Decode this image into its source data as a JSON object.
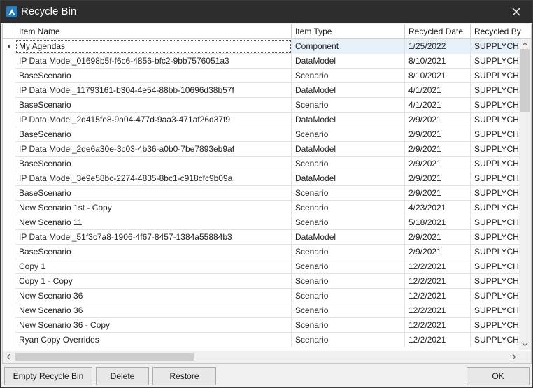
{
  "window": {
    "title": "Recycle Bin",
    "icon": "app-logo-icon",
    "accent": "#1f7fc4"
  },
  "columns": [
    "Item Name",
    "Item Type",
    "Recycled Date",
    "Recycled By"
  ],
  "rows": [
    {
      "name": "My Agendas",
      "type": "Component",
      "date": "1/25/2022",
      "by": "SUPPLYCHA"
    },
    {
      "name": "IP Data Model_01698b5f-f6c6-4856-bfc2-9bb7576051a3",
      "type": "DataModel",
      "date": "8/10/2021",
      "by": "SUPPLYCHA"
    },
    {
      "name": "BaseScenario",
      "type": "Scenario",
      "date": "8/10/2021",
      "by": "SUPPLYCHA"
    },
    {
      "name": "IP Data Model_11793161-b304-4e54-88bb-10696d38b57f",
      "type": "DataModel",
      "date": "4/1/2021",
      "by": "SUPPLYCHA"
    },
    {
      "name": "BaseScenario",
      "type": "Scenario",
      "date": "4/1/2021",
      "by": "SUPPLYCHA"
    },
    {
      "name": "IP Data Model_2d415fe8-9a04-477d-9aa3-471af26d37f9",
      "type": "DataModel",
      "date": "2/9/2021",
      "by": "SUPPLYCHA"
    },
    {
      "name": "BaseScenario",
      "type": "Scenario",
      "date": "2/9/2021",
      "by": "SUPPLYCHA"
    },
    {
      "name": "IP Data Model_2de6a30e-3c03-4b36-a0b0-7be7893eb9af",
      "type": "DataModel",
      "date": "2/9/2021",
      "by": "SUPPLYCHA"
    },
    {
      "name": "BaseScenario",
      "type": "Scenario",
      "date": "2/9/2021",
      "by": "SUPPLYCHA"
    },
    {
      "name": "IP Data Model_3e9e58bc-2274-4835-8bc1-c918cfc9b09a",
      "type": "DataModel",
      "date": "2/9/2021",
      "by": "SUPPLYCHA"
    },
    {
      "name": "BaseScenario",
      "type": "Scenario",
      "date": "2/9/2021",
      "by": "SUPPLYCHA"
    },
    {
      "name": "New Scenario 1st - Copy",
      "type": "Scenario",
      "date": "4/23/2021",
      "by": "SUPPLYCHA"
    },
    {
      "name": "New Scenario 11",
      "type": "Scenario",
      "date": "5/18/2021",
      "by": "SUPPLYCHA"
    },
    {
      "name": "IP Data Model_51f3c7a8-1906-4f67-8457-1384a55884b3",
      "type": "DataModel",
      "date": "2/9/2021",
      "by": "SUPPLYCHA"
    },
    {
      "name": "BaseScenario",
      "type": "Scenario",
      "date": "2/9/2021",
      "by": "SUPPLYCHA"
    },
    {
      "name": "Copy 1",
      "type": "Scenario",
      "date": "12/2/2021",
      "by": "SUPPLYCHA"
    },
    {
      "name": "Copy 1 - Copy",
      "type": "Scenario",
      "date": "12/2/2021",
      "by": "SUPPLYCHA"
    },
    {
      "name": "New Scenario 36",
      "type": "Scenario",
      "date": "12/2/2021",
      "by": "SUPPLYCHA"
    },
    {
      "name": "New Scenario 36",
      "type": "Scenario",
      "date": "12/2/2021",
      "by": "SUPPLYCHA"
    },
    {
      "name": "New Scenario 36 - Copy",
      "type": "Scenario",
      "date": "12/2/2021",
      "by": "SUPPLYCHA"
    },
    {
      "name": "Ryan Copy Overrides",
      "type": "Scenario",
      "date": "12/2/2021",
      "by": "SUPPLYCHA"
    }
  ],
  "selected_row": 0,
  "buttons": {
    "empty": "Empty Recycle Bin",
    "delete": "Delete",
    "restore": "Restore",
    "ok": "OK"
  }
}
